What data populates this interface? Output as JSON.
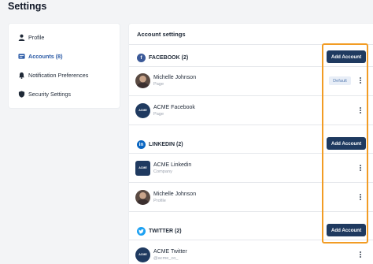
{
  "page": {
    "title": "Settings"
  },
  "sidebar": {
    "items": [
      {
        "label": "Profile",
        "icon": "person-icon",
        "active": false
      },
      {
        "label": "Accounts (8)",
        "icon": "accounts-icon",
        "active": true
      },
      {
        "label": "Notification Preferences",
        "icon": "bell-icon",
        "active": false
      },
      {
        "label": "Security Settings",
        "icon": "shield-icon",
        "active": false
      }
    ]
  },
  "main": {
    "title": "Account settings",
    "add_label": "Add Account",
    "sections": [
      {
        "label": "FACEBOOK (2)",
        "icon": "facebook-icon",
        "accounts": [
          {
            "name": "Michelle Johnson",
            "type": "Page",
            "badge": "Default"
          },
          {
            "name": "ACME Facebook",
            "type": "Page"
          }
        ]
      },
      {
        "label": "LINKEDIN (2)",
        "icon": "linkedin-icon",
        "accounts": [
          {
            "name": "ACME Linkedin",
            "type": "Company"
          },
          {
            "name": "Michelle Johnson",
            "type": "Profile"
          }
        ]
      },
      {
        "label": "TWITTER (2)",
        "icon": "twitter-icon",
        "accounts": [
          {
            "name": "ACME Twitter",
            "type": "@acme_co_"
          }
        ]
      }
    ]
  },
  "logo_text": "ACME",
  "colors": {
    "accent": "#1f3a60",
    "active_link": "#2a5aa6",
    "highlight": "#f29c24",
    "facebook": "#3b5998",
    "linkedin": "#0a66c2",
    "twitter": "#1da1f2"
  }
}
